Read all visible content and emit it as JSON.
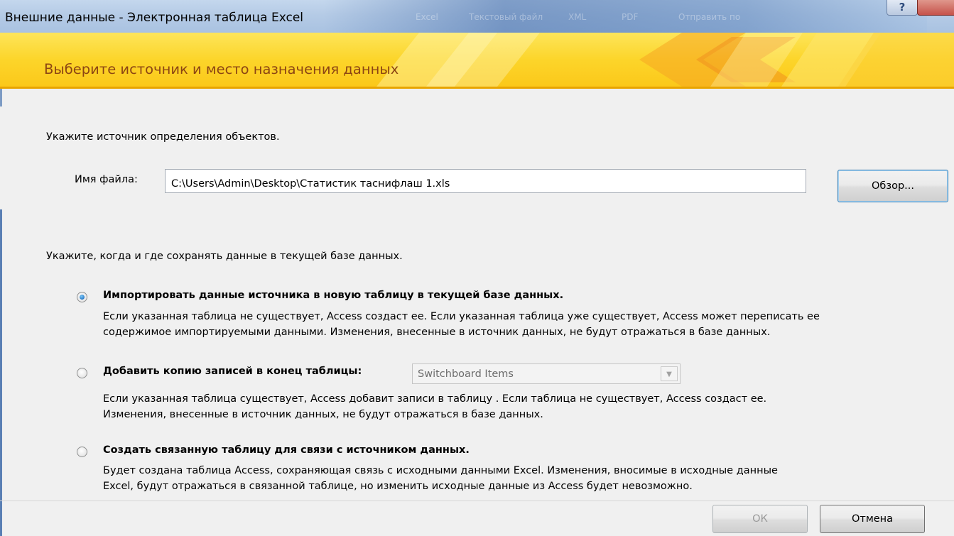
{
  "window": {
    "title": "Внешние данные - Электронная таблица Excel",
    "help_label": "?",
    "background_ribbon": [
      "Excel",
      "Текстовый файл",
      "XML",
      "PDF",
      "Отправить по"
    ]
  },
  "banner": {
    "heading": "Выберите источник и место назначения данных",
    "colors": {
      "top": "#fde55a",
      "bottom": "#fbc81a",
      "heading_text": "#8c4513"
    }
  },
  "source": {
    "prompt": "Укажите источник определения объектов.",
    "file_label": "Имя файла:",
    "file_value": "C:\\Users\\Admin\\Desktop\\Статистик таснифлаш 1.xls",
    "browse_label": "Обзор..."
  },
  "destination": {
    "prompt": "Укажите, когда и где сохранять данные в текущей базе данных.",
    "options": [
      {
        "label": "Импортировать данные источника в новую таблицу в текущей базе данных.",
        "checked": true,
        "description": [
          "Если указанная таблица не существует, Access создаст ее. Если указанная таблица уже существует, Access может переписать ее",
          "содержимое импортируемыми данными. Изменения, внесенные в источник данных, не будут отражаться в базе данных."
        ]
      },
      {
        "label": "Добавить копию записей в конец таблицы:",
        "checked": false,
        "combo_value": "Switchboard Items",
        "description": [
          "Если указанная таблица существует, Access добавит записи в таблицу . Если таблица не существует, Access создаст ее.",
          "Изменения, внесенные в источник данных, не будут отражаться в базе данных."
        ]
      },
      {
        "label": "Создать связанную таблицу для связи с источником данных.",
        "checked": false,
        "description": [
          "Будет создана таблица Access, сохраняющая связь с исходными данными Excel. Изменения, вносимые в исходные данные",
          "Excel, будут отражаться в связанной таблице, но изменить исходные данные из Access будет невозможно."
        ]
      }
    ]
  },
  "footer": {
    "ok_label": "ОК",
    "cancel_label": "Отмена"
  }
}
